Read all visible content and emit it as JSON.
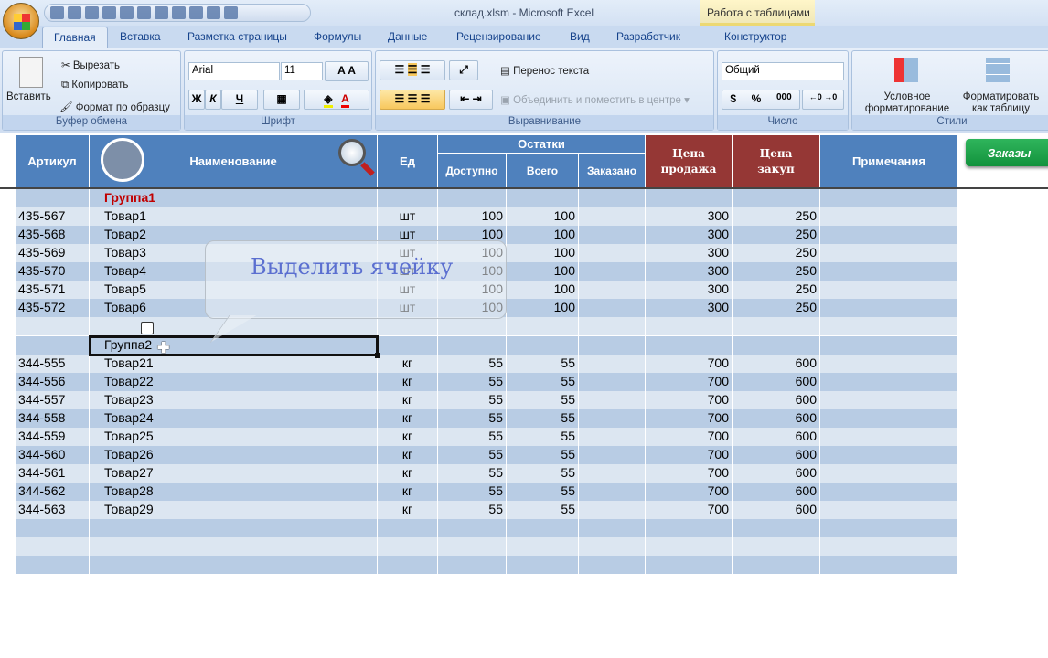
{
  "window": {
    "title": "склад.xlsm - Microsoft Excel",
    "context_tab_group": "Работа с таблицами"
  },
  "tabs": [
    "Главная",
    "Вставка",
    "Разметка страницы",
    "Формулы",
    "Данные",
    "Рецензирование",
    "Вид",
    "Разработчик",
    "Конструктор"
  ],
  "ribbon": {
    "clipboard": {
      "label": "Буфер обмена",
      "paste": "Вставить",
      "cut": "Вырезать",
      "copy": "Копировать",
      "format_painter": "Формат по образцу"
    },
    "font": {
      "label": "Шрифт",
      "font_name": "Arial",
      "font_size": "11",
      "bold": "Ж",
      "italic": "К",
      "underline": "Ч"
    },
    "alignment": {
      "label": "Выравнивание",
      "wrap": "Перенос текста",
      "merge": "Объединить и поместить в центре"
    },
    "number": {
      "label": "Число",
      "format": "Общий",
      "currency": "$",
      "percent": "%",
      "thousands": "000"
    },
    "styles": {
      "label": "Стили",
      "conditional": "Условное форматирование",
      "as_table": "Форматировать как таблицу"
    }
  },
  "table": {
    "headers": {
      "article": "Артикул",
      "name": "Наименование",
      "unit": "Ед",
      "stock": "Остатки",
      "available": "Доступно",
      "total": "Всего",
      "ordered": "Заказано",
      "sell_price": "Цена продажа",
      "buy_price": "Цена закуп",
      "notes": "Примечания"
    },
    "rows": [
      {
        "group": "Группа1"
      },
      {
        "art": "435-567",
        "name": "Товар1",
        "unit": "шт",
        "avail": "100",
        "total": "100",
        "sell": "300",
        "buy": "250"
      },
      {
        "art": "435-568",
        "name": "Товар2",
        "unit": "шт",
        "avail": "100",
        "total": "100",
        "sell": "300",
        "buy": "250"
      },
      {
        "art": "435-569",
        "name": "Товар3",
        "unit": "шт",
        "avail": "100",
        "total": "100",
        "sell": "300",
        "buy": "250"
      },
      {
        "art": "435-570",
        "name": "Товар4",
        "unit": "шт",
        "avail": "100",
        "total": "100",
        "sell": "300",
        "buy": "250"
      },
      {
        "art": "435-571",
        "name": "Товар5",
        "unit": "шт",
        "avail": "100",
        "total": "100",
        "sell": "300",
        "buy": "250"
      },
      {
        "art": "435-572",
        "name": "Товар6",
        "unit": "шт",
        "avail": "100",
        "total": "100",
        "sell": "300",
        "buy": "250"
      },
      {},
      {
        "name": "Группа2"
      },
      {
        "art": "344-555",
        "name": "Товар21",
        "unit": "кг",
        "avail": "55",
        "total": "55",
        "sell": "700",
        "buy": "600"
      },
      {
        "art": "344-556",
        "name": "Товар22",
        "unit": "кг",
        "avail": "55",
        "total": "55",
        "sell": "700",
        "buy": "600"
      },
      {
        "art": "344-557",
        "name": "Товар23",
        "unit": "кг",
        "avail": "55",
        "total": "55",
        "sell": "700",
        "buy": "600"
      },
      {
        "art": "344-558",
        "name": "Товар24",
        "unit": "кг",
        "avail": "55",
        "total": "55",
        "sell": "700",
        "buy": "600"
      },
      {
        "art": "344-559",
        "name": "Товар25",
        "unit": "кг",
        "avail": "55",
        "total": "55",
        "sell": "700",
        "buy": "600"
      },
      {
        "art": "344-560",
        "name": "Товар26",
        "unit": "кг",
        "avail": "55",
        "total": "55",
        "sell": "700",
        "buy": "600"
      },
      {
        "art": "344-561",
        "name": "Товар27",
        "unit": "кг",
        "avail": "55",
        "total": "55",
        "sell": "700",
        "buy": "600"
      },
      {
        "art": "344-562",
        "name": "Товар28",
        "unit": "кг",
        "avail": "55",
        "total": "55",
        "sell": "700",
        "buy": "600"
      },
      {
        "art": "344-563",
        "name": "Товар29",
        "unit": "кг",
        "avail": "55",
        "total": "55",
        "sell": "700",
        "buy": "600"
      },
      {},
      {},
      {}
    ]
  },
  "orders_button": "Заказы",
  "callout": "Выделить ячейку"
}
